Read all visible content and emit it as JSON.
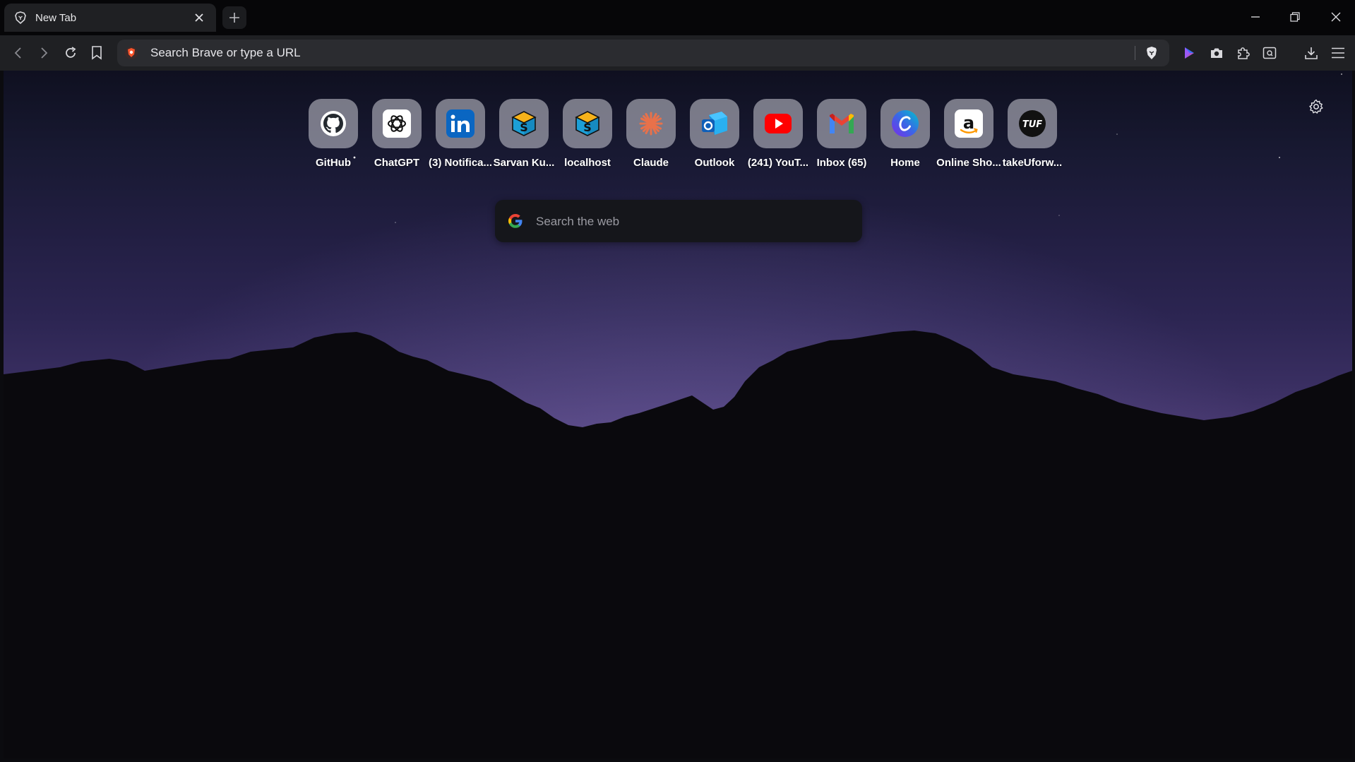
{
  "tab": {
    "title": "New Tab",
    "favicon": "brave-lion-icon"
  },
  "toolbar": {
    "omnibox_placeholder": "Search Brave or type a URL"
  },
  "topsites": [
    {
      "label": "GitHub",
      "icon": "github-icon"
    },
    {
      "label": "ChatGPT",
      "icon": "chatgpt-icon"
    },
    {
      "label": "(3) Notifica...",
      "icon": "linkedin-icon"
    },
    {
      "label": "Sarvan Ku...",
      "icon": "cube-s-icon"
    },
    {
      "label": "localhost",
      "icon": "cube-s-icon"
    },
    {
      "label": "Claude",
      "icon": "claude-icon"
    },
    {
      "label": "Outlook",
      "icon": "outlook-icon"
    },
    {
      "label": "(241) YouT...",
      "icon": "youtube-icon"
    },
    {
      "label": "Inbox (65)",
      "icon": "gmail-icon"
    },
    {
      "label": "Home",
      "icon": "canva-icon"
    },
    {
      "label": "Online Sho...",
      "icon": "amazon-icon"
    },
    {
      "label": "takeUforw...",
      "icon": "tuf-icon"
    }
  ],
  "search": {
    "placeholder": "Search the web"
  },
  "colors": {
    "titlebar": "#060608",
    "toolbar": "#1f2023",
    "omnibox": "#2b2c30",
    "brave_orange": "#fb542b",
    "youtube_red": "#ff0000",
    "linkedin_blue": "#0a66c2"
  }
}
